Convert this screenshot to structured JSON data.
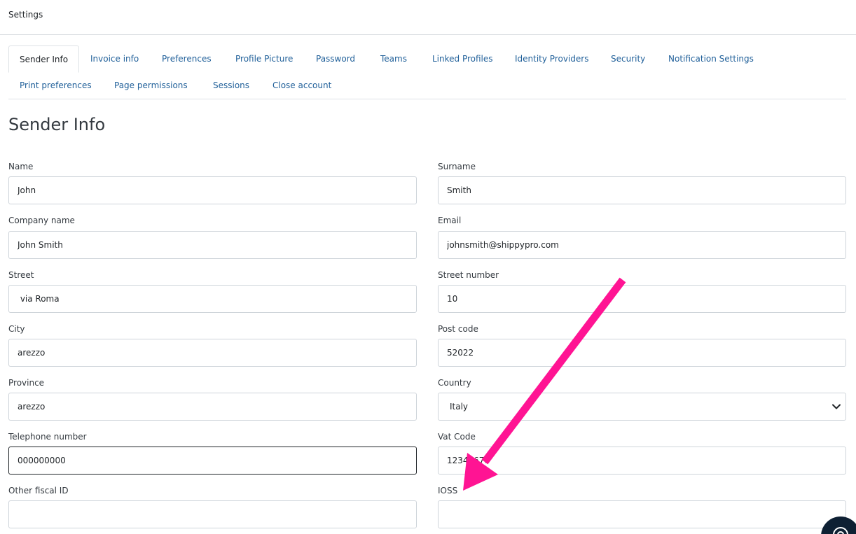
{
  "header": {
    "title": "Settings"
  },
  "tabs": [
    {
      "label": "Sender Info"
    },
    {
      "label": "Invoice info"
    },
    {
      "label": "Preferences"
    },
    {
      "label": "Profile Picture"
    },
    {
      "label": "Password"
    },
    {
      "label": "Teams"
    },
    {
      "label": "Linked Profiles"
    },
    {
      "label": "Identity Providers"
    },
    {
      "label": "Security"
    },
    {
      "label": "Notification Settings"
    },
    {
      "label": "Print preferences"
    },
    {
      "label": "Page permissions"
    },
    {
      "label": "Sessions"
    },
    {
      "label": "Close account"
    }
  ],
  "active_tab": "Sender Info",
  "page": {
    "title": "Sender Info"
  },
  "form": {
    "name": {
      "label": "Name",
      "value": "John"
    },
    "surname": {
      "label": "Surname",
      "value": "Smith"
    },
    "company": {
      "label": "Company name",
      "value": "John Smith"
    },
    "email": {
      "label": "Email",
      "value": "johnsmith@shippypro.com"
    },
    "street": {
      "label": "Street",
      "value": " via Roma"
    },
    "street_number": {
      "label": "Street number",
      "value": "10"
    },
    "city": {
      "label": "City",
      "value": "arezzo"
    },
    "post_code": {
      "label": "Post code",
      "value": "52022"
    },
    "province": {
      "label": "Province",
      "value": "arezzo"
    },
    "country": {
      "label": "Country",
      "value": "Italy"
    },
    "telephone": {
      "label": "Telephone number",
      "value": "000000000"
    },
    "vat": {
      "label": "Vat Code",
      "value": "12345678"
    },
    "other_fiscal": {
      "label": "Other fiscal ID",
      "value": ""
    },
    "ioss": {
      "label": "IOSS",
      "value": ""
    }
  },
  "colors": {
    "link": "#1f5f99",
    "arrow": "#ff1493",
    "help_button": "#0e2033"
  },
  "icons": {
    "country_select": "chevron-down-icon",
    "help": "help-chat-icon"
  },
  "annotation": {
    "type": "arrow",
    "color": "#ff1493",
    "points_to": "IOSS"
  }
}
